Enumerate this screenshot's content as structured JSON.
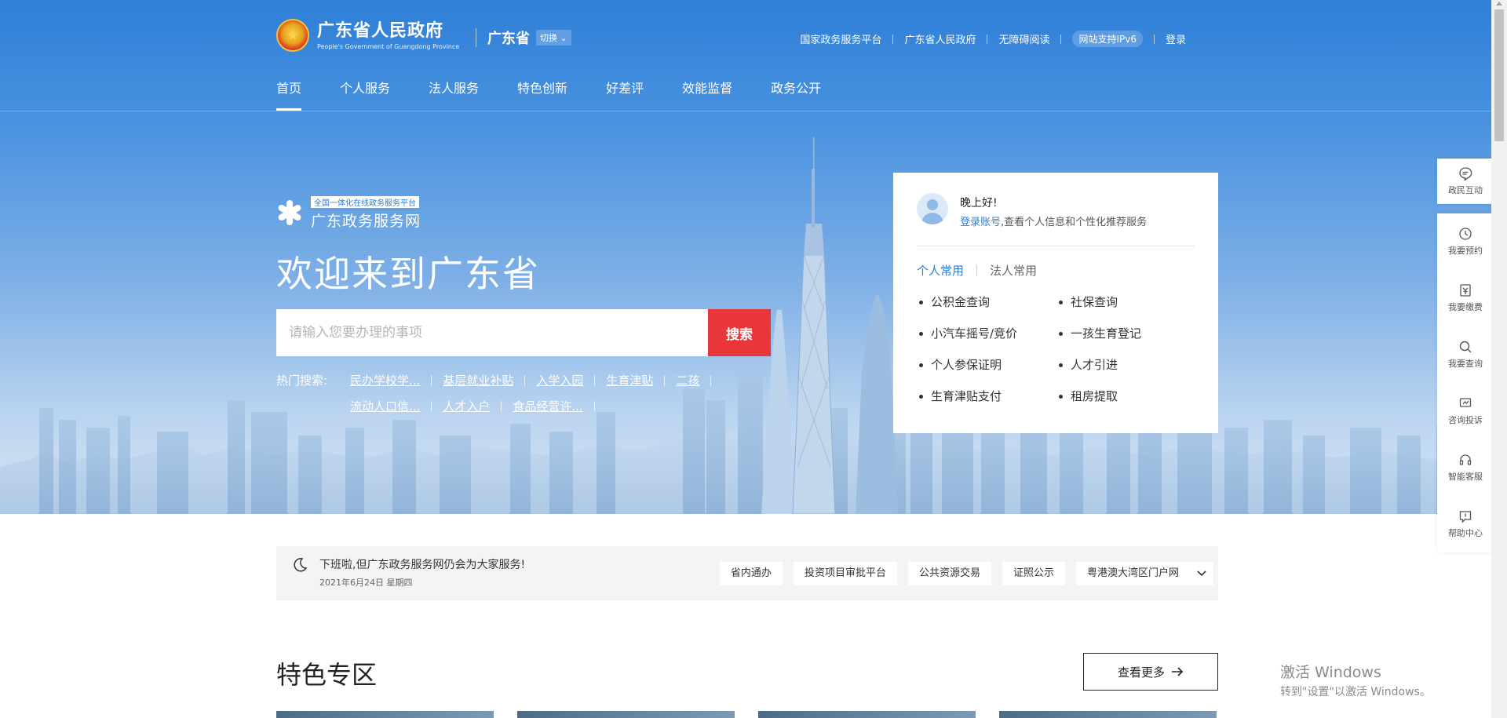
{
  "header": {
    "gov_name": "广东省人民政府",
    "gov_name_en": "People's Government of Guangdong Province",
    "region": "广东省",
    "region_switch": "切换",
    "links": [
      "国家政务服务平台",
      "广东省人民政府",
      "无障碍阅读",
      "网站支持IPv6",
      "登录"
    ]
  },
  "nav": {
    "items": [
      "首页",
      "个人服务",
      "法人服务",
      "特色创新",
      "好差评",
      "效能监督",
      "政务公开"
    ]
  },
  "hero": {
    "brand_tag": "全国一体化在线政务服务平台",
    "brand_name": "广东政务服务网",
    "welcome": "欢迎来到广东省",
    "search_placeholder": "请输入您要办理的事项",
    "search_button": "搜索",
    "hot_label": "热门搜索:",
    "hot_items": [
      "民办学校学...",
      "基层就业补贴",
      "入学入园",
      "生育津贴",
      "二孩",
      "流动人口信...",
      "人才入户",
      "食品经营许..."
    ]
  },
  "user_card": {
    "greeting": "晚上好!",
    "login_link": "登录账号",
    "login_hint": ",查看个人信息和个性化推荐服务",
    "tabs": [
      "个人常用",
      "法人常用"
    ],
    "services": [
      "公积金查询",
      "社保查询",
      "小汽车摇号/竞价",
      "一孩生育登记",
      "个人参保证明",
      "人才引进",
      "生育津贴支付",
      "租房提取"
    ]
  },
  "float_sidebar": {
    "top": {
      "label": "政民互动",
      "icon": "chat-icon"
    },
    "items": [
      {
        "label": "我要预约",
        "icon": "clock-icon"
      },
      {
        "label": "我要缴费",
        "icon": "yuan-icon"
      },
      {
        "label": "我要查询",
        "icon": "search-icon"
      },
      {
        "label": "咨询投诉",
        "icon": "complaint-icon"
      },
      {
        "label": "智能客服",
        "icon": "headset-icon"
      },
      {
        "label": "帮助中心",
        "icon": "help-icon"
      }
    ]
  },
  "notice": {
    "title": "下班啦,但广东政务服务网仍会为大家服务!",
    "date": "2021年6月24日 星期四",
    "quick_links": [
      "省内通办",
      "投资项目审批平台",
      "公共资源交易",
      "证照公示",
      "粤港澳大湾区门户网"
    ]
  },
  "section": {
    "title": "特色专区",
    "more": "查看更多"
  },
  "watermark": {
    "title": "激活 Windows",
    "subtitle": "转到\"设置\"以激活 Windows。"
  }
}
